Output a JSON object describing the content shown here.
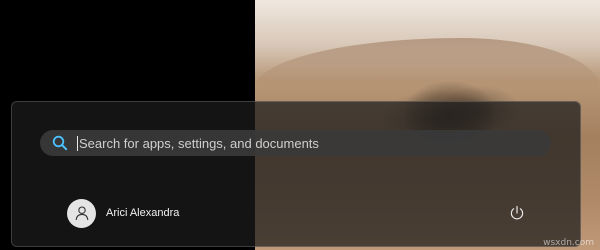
{
  "start_menu": {
    "search": {
      "placeholder": "Search for apps, settings, and documents",
      "icon": "search-icon"
    },
    "user": {
      "name": "Arici Alexandra",
      "icon": "person-icon"
    },
    "power": {
      "icon": "power-icon"
    }
  },
  "watermark": "wsxdn.com",
  "colors": {
    "panel": "#1c1c1c",
    "search_box": "#3a3a3a",
    "search_icon_accent": "#4cc2ff",
    "text": "#f0f0f0"
  }
}
